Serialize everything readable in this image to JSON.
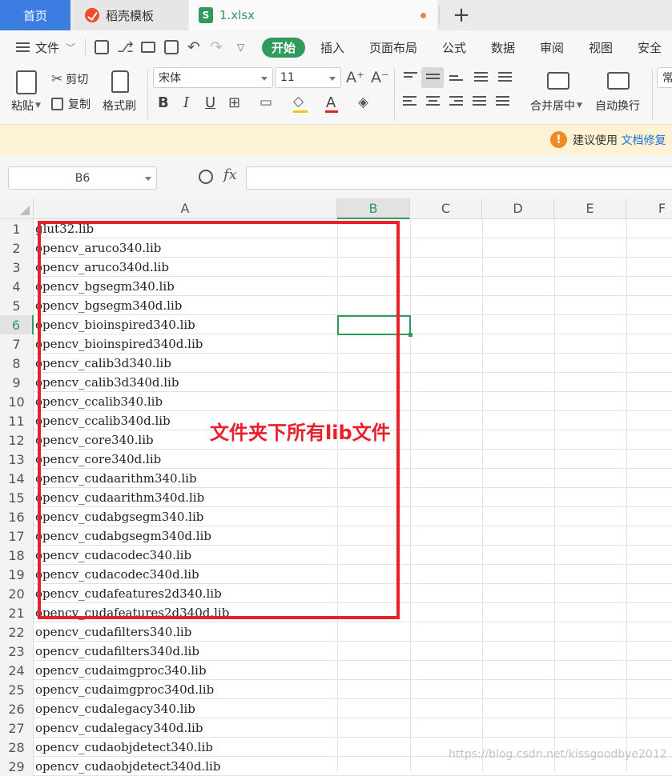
{
  "tabs": {
    "home": "首页",
    "doc": "稻壳模板",
    "file": "1.xlsx",
    "file_icon": "S",
    "add": "+"
  },
  "menu": {
    "file": "文件",
    "start": "开始",
    "items": [
      "插入",
      "页面布局",
      "公式",
      "数据",
      "审阅",
      "视图",
      "安全"
    ]
  },
  "ribbon": {
    "paste": "粘贴",
    "cut": "剪切",
    "copy": "复制",
    "format_painter": "格式刷",
    "font_name": "宋体",
    "font_size": "11",
    "merge_center": "合并居中",
    "wrap_text": "自动换行",
    "overflow": "常"
  },
  "notice": {
    "text": "建议使用",
    "link": "文档修复"
  },
  "formula_bar": {
    "name_box": "B6",
    "fx": "fx",
    "value": ""
  },
  "grid": {
    "columns": [
      "A",
      "B",
      "C",
      "D",
      "E",
      "F"
    ],
    "active_column": "B",
    "active_row": "6",
    "rows": [
      {
        "n": "1",
        "a": "glut32.lib"
      },
      {
        "n": "2",
        "a": "opencv_aruco340.lib"
      },
      {
        "n": "3",
        "a": "opencv_aruco340d.lib"
      },
      {
        "n": "4",
        "a": "opencv_bgsegm340.lib"
      },
      {
        "n": "5",
        "a": "opencv_bgsegm340d.lib"
      },
      {
        "n": "6",
        "a": "opencv_bioinspired340.lib"
      },
      {
        "n": "7",
        "a": "opencv_bioinspired340d.lib"
      },
      {
        "n": "8",
        "a": "opencv_calib3d340.lib"
      },
      {
        "n": "9",
        "a": "opencv_calib3d340d.lib"
      },
      {
        "n": "10",
        "a": "opencv_ccalib340.lib"
      },
      {
        "n": "11",
        "a": "opencv_ccalib340d.lib"
      },
      {
        "n": "12",
        "a": "opencv_core340.lib"
      },
      {
        "n": "13",
        "a": "opencv_core340d.lib"
      },
      {
        "n": "14",
        "a": "opencv_cudaarithm340.lib"
      },
      {
        "n": "15",
        "a": "opencv_cudaarithm340d.lib"
      },
      {
        "n": "16",
        "a": "opencv_cudabgsegm340.lib"
      },
      {
        "n": "17",
        "a": "opencv_cudabgsegm340d.lib"
      },
      {
        "n": "18",
        "a": "opencv_cudacodec340.lib"
      },
      {
        "n": "19",
        "a": "opencv_cudacodec340d.lib"
      },
      {
        "n": "20",
        "a": "opencv_cudafeatures2d340.lib"
      },
      {
        "n": "21",
        "a": "opencv_cudafeatures2d340d.lib"
      },
      {
        "n": "22",
        "a": "opencv_cudafilters340.lib"
      },
      {
        "n": "23",
        "a": "opencv_cudafilters340d.lib"
      },
      {
        "n": "24",
        "a": "opencv_cudaimgproc340.lib"
      },
      {
        "n": "25",
        "a": "opencv_cudaimgproc340d.lib"
      },
      {
        "n": "26",
        "a": "opencv_cudalegacy340.lib"
      },
      {
        "n": "27",
        "a": "opencv_cudalegacy340d.lib"
      },
      {
        "n": "28",
        "a": "opencv_cudaobjdetect340.lib"
      },
      {
        "n": "29",
        "a": "opencv_cudaobjdetect340d.lib"
      }
    ]
  },
  "annotation": {
    "label": "文件夹下所有lib文件",
    "color": "#e8202b"
  },
  "watermark": "https://blog.csdn.net/kissgoodbye2012",
  "colors": {
    "accent_green": "#2f9a5b",
    "tab_blue": "#3b7de1",
    "notice_bg": "#fdf2d3"
  }
}
